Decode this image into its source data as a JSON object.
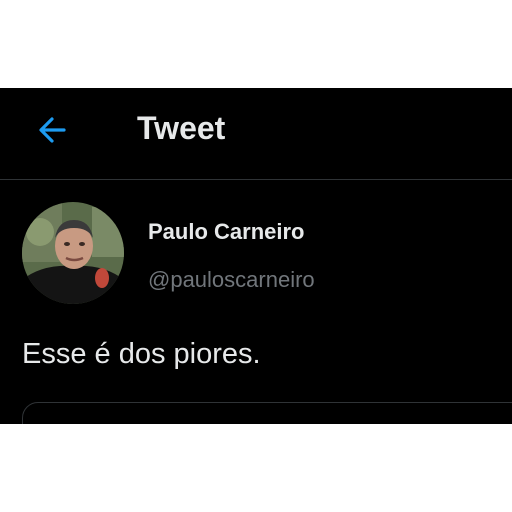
{
  "header": {
    "title": "Tweet",
    "back_icon": "arrow-left-icon",
    "accent_color": "#1d9bf0"
  },
  "tweet": {
    "author": {
      "display_name": "Paulo Carneiro",
      "handle": "@pauloscarneiro",
      "avatar_icon": "avatar-photo"
    },
    "text": "Esse é dos piores."
  },
  "colors": {
    "background": "#000000",
    "text_primary": "#e7e9ea",
    "text_secondary": "#71767b",
    "divider": "#2f3336"
  }
}
